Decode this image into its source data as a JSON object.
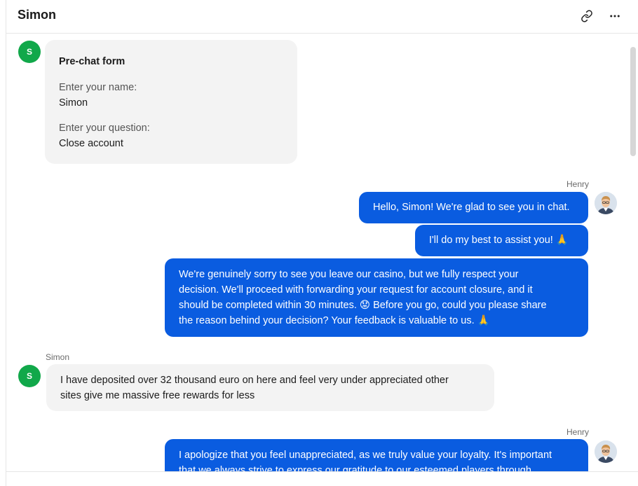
{
  "header": {
    "title": "Simon",
    "link_icon": "link-icon",
    "more_icon": "more-horizontal-icon"
  },
  "avatars": {
    "simon_initial": "S",
    "simon_color": "#11a84a"
  },
  "pre_chat_form": {
    "title": "Pre-chat form",
    "name_label": "Enter your name:",
    "name_value": "Simon",
    "question_label": "Enter your question:",
    "question_value": "Close account"
  },
  "messages": [
    {
      "sender": "Henry",
      "lines": [
        "Hello, Simon! We're glad to see you in chat."
      ]
    },
    {
      "sender": "",
      "lines": [
        "I'll do my best to assist you! 🙏"
      ]
    },
    {
      "sender": "",
      "lines": [
        "We're genuinely sorry to see you leave our casino, but we fully respect your",
        "decision. We'll proceed with forwarding your request for account closure, and it",
        "should be completed within 30 minutes. 😟 Before you go, could you please share",
        "the reason behind your decision? Your feedback is valuable to us. 🙏"
      ]
    },
    {
      "sender": "Simon",
      "lines": [
        "I have deposited over 32 thousand euro on here and feel very under appreciated other",
        "sites give me massive free rewards for less"
      ]
    },
    {
      "sender": "Henry",
      "lines": [
        "I apologize that you feel unappreciated, as we truly value your loyalty. It's important",
        "that we always strive to express our gratitude to our esteemed players through"
      ]
    }
  ],
  "colors": {
    "agent_bubble": "#0a5ce0",
    "visitor_bubble": "#f3f3f3"
  }
}
